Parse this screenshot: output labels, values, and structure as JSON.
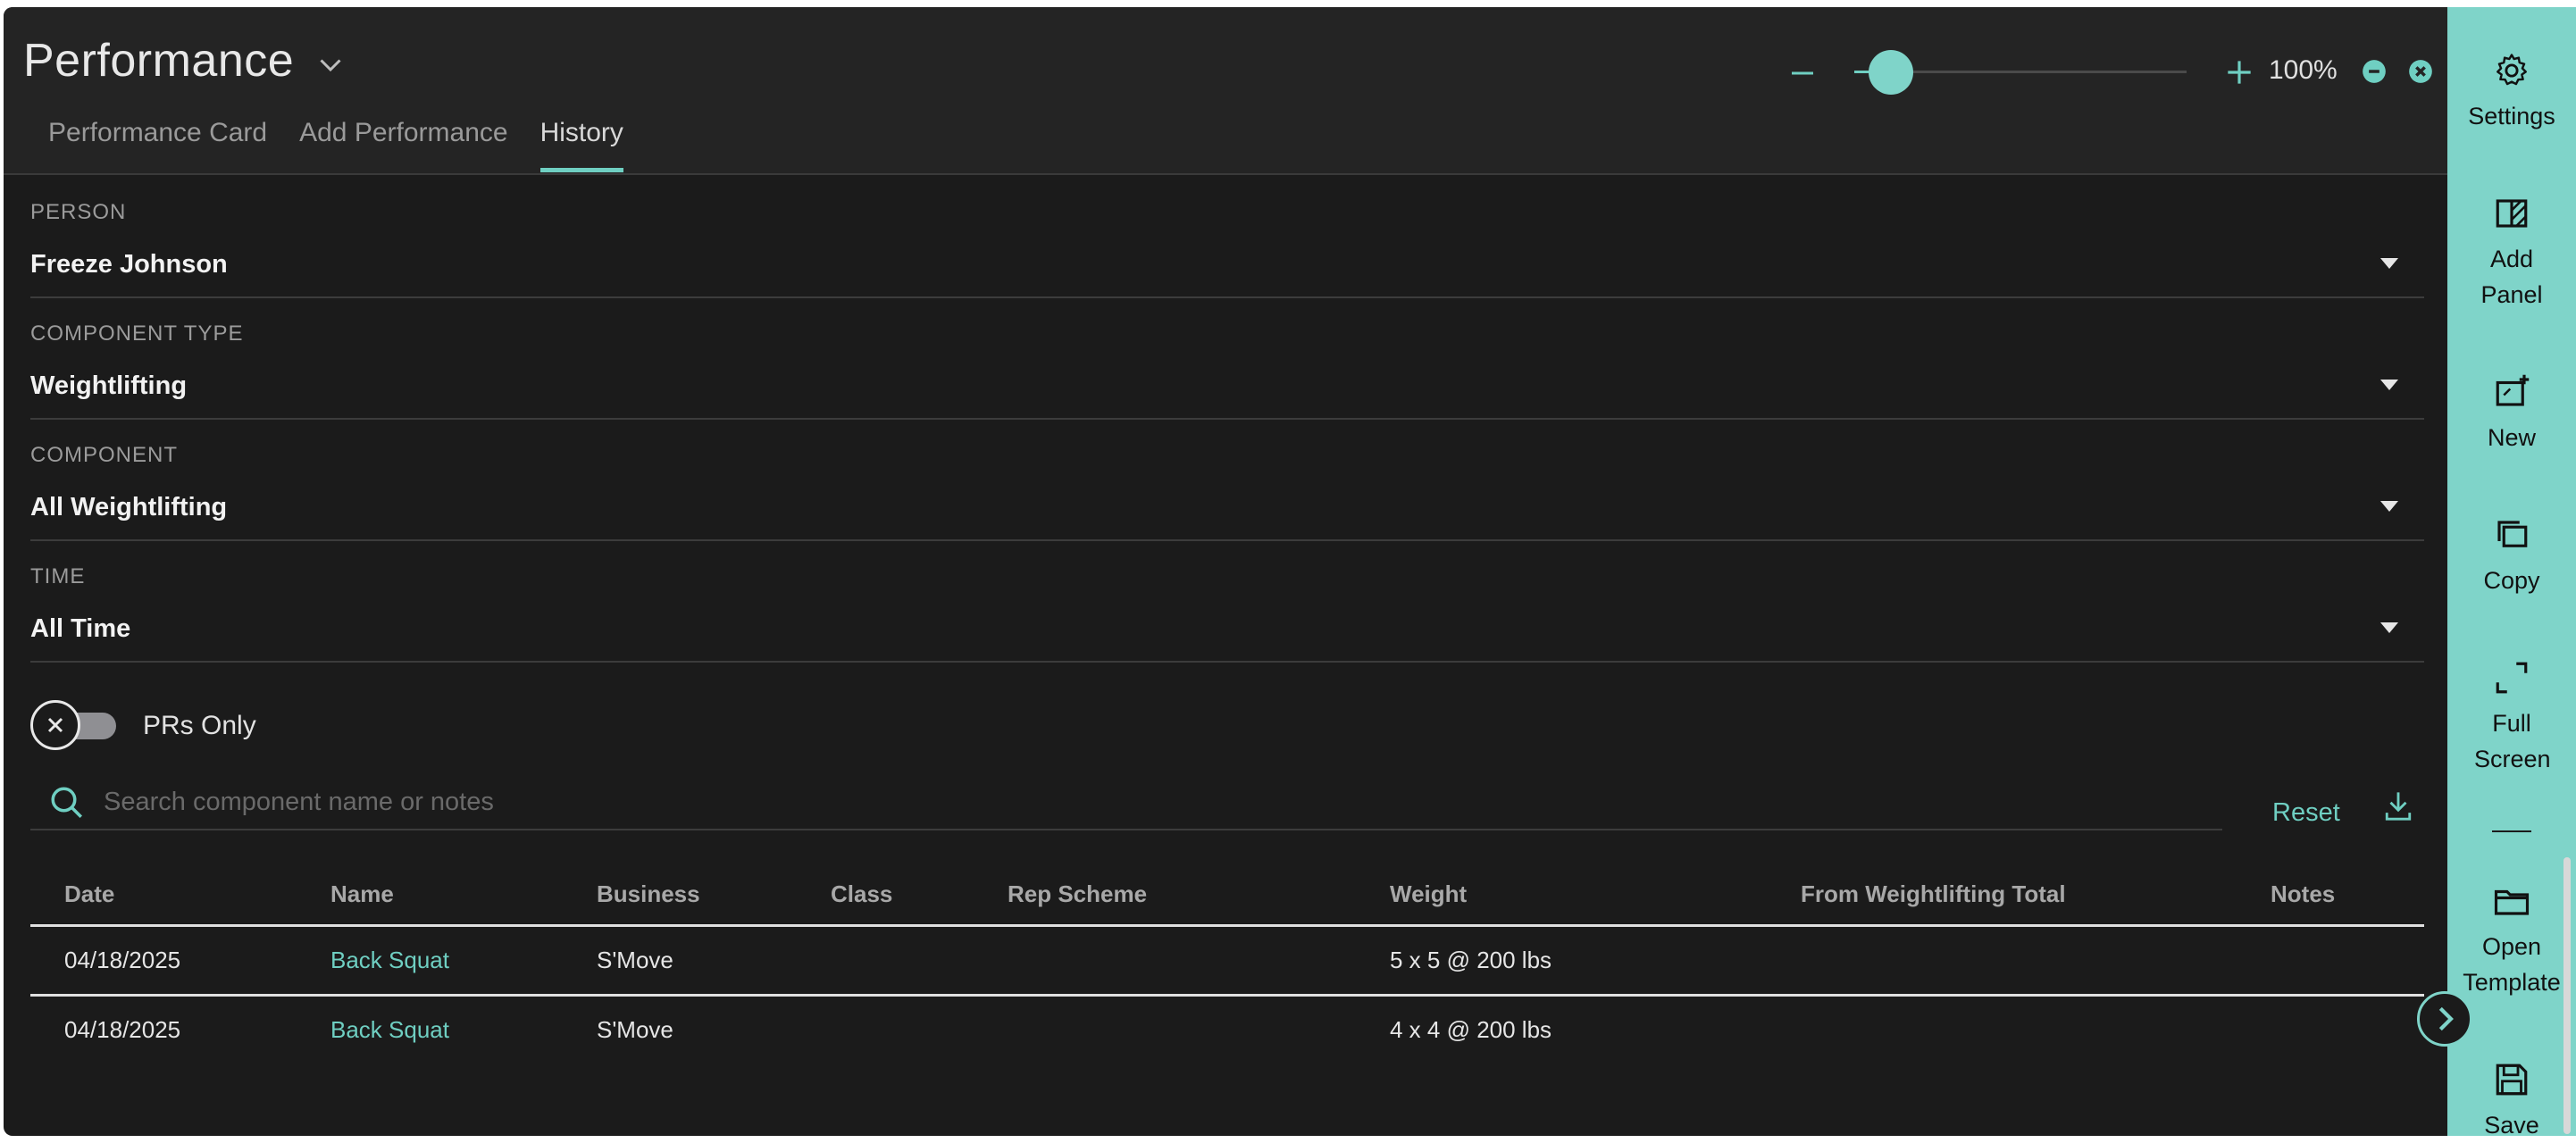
{
  "header": {
    "title": "Performance",
    "tabs": [
      {
        "label": "Performance Card",
        "active": false
      },
      {
        "label": "Add Performance",
        "active": false
      },
      {
        "label": "History",
        "active": true
      }
    ],
    "zoom": {
      "value": "100%"
    }
  },
  "filters": {
    "person": {
      "label": "PERSON",
      "value": "Freeze Johnson"
    },
    "component_type": {
      "label": "COMPONENT TYPE",
      "value": "Weightlifting"
    },
    "component": {
      "label": "COMPONENT",
      "value": "All Weightlifting"
    },
    "time": {
      "label": "TIME",
      "value": "All Time"
    }
  },
  "toggle": {
    "label": "PRs Only",
    "on": false
  },
  "search": {
    "placeholder": "Search component name or notes",
    "value": ""
  },
  "actions": {
    "reset_label": "Reset"
  },
  "table": {
    "columns": [
      "Date",
      "Name",
      "Business",
      "Class",
      "Rep Scheme",
      "Weight",
      "From Weightlifting Total",
      "Notes"
    ],
    "rows": [
      {
        "date": "04/18/2025",
        "name": "Back Squat",
        "business": "S'Move",
        "class": "",
        "rep_scheme": "",
        "weight": "5 x 5 @ 200 lbs",
        "from_total": "",
        "notes": ""
      },
      {
        "date": "04/18/2025",
        "name": "Back Squat",
        "business": "S'Move",
        "class": "",
        "rep_scheme": "",
        "weight": "4 x 4 @ 200 lbs",
        "from_total": "",
        "notes": ""
      }
    ]
  },
  "sidebar": {
    "items": [
      {
        "label": "Settings",
        "icon": "gear-icon"
      },
      {
        "label": "Add Panel",
        "icon": "add-panel-icon"
      },
      {
        "label": "New",
        "icon": "new-window-icon"
      },
      {
        "label": "Copy",
        "icon": "copy-icon"
      },
      {
        "label": "Full Screen",
        "icon": "fullscreen-icon"
      },
      {
        "label": "Open Template",
        "icon": "folder-icon"
      },
      {
        "label": "Save",
        "icon": "save-icon"
      }
    ]
  },
  "colors": {
    "accent": "#7fd4c9",
    "background": "#1b1b1b",
    "header": "#242424"
  }
}
